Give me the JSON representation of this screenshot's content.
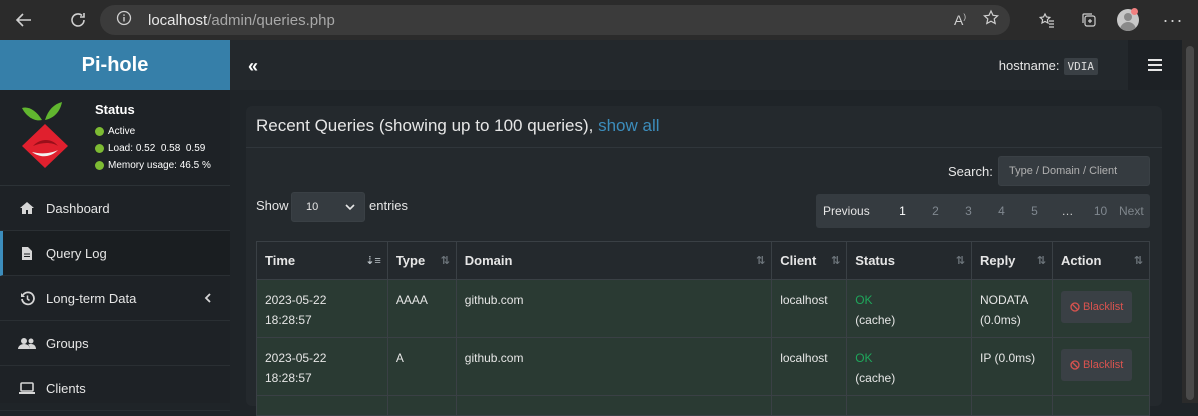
{
  "browser": {
    "url_host": "localhost",
    "url_path": "/admin/queries.php"
  },
  "sidebar": {
    "brand": "Pi-hole",
    "status": {
      "title": "Status",
      "active": "Active",
      "load_label": "Load:",
      "load_values": "0.52  0.58  0.59",
      "memory_label": "Memory usage:",
      "memory_value": "46.5 %"
    },
    "items": [
      {
        "label": "Dashboard",
        "icon": "home-icon"
      },
      {
        "label": "Query Log",
        "icon": "file-icon"
      },
      {
        "label": "Long-term Data",
        "icon": "history-icon"
      },
      {
        "label": "Groups",
        "icon": "users-icon"
      },
      {
        "label": "Clients",
        "icon": "laptop-icon"
      }
    ]
  },
  "header": {
    "toggle": "«",
    "hostname_label": "hostname:",
    "hostname_value": "VDIA"
  },
  "main": {
    "title": "Recent Queries (showing up to 100 queries), ",
    "show_all": "show all",
    "search_label": "Search:",
    "search_placeholder": "Type / Domain / Client",
    "show_label": "Show",
    "entries_value": "10",
    "entries_label": "entries",
    "pager": {
      "previous": "Previous",
      "pages": [
        "1",
        "2",
        "3",
        "4",
        "5",
        "…",
        "10"
      ],
      "next": "Next"
    },
    "columns": [
      "Time",
      "Type",
      "Domain",
      "Client",
      "Status",
      "Reply",
      "Action"
    ],
    "rows": [
      {
        "date": "2023-05-22",
        "time": "18:28:57",
        "type": "AAAA",
        "domain": "github.com",
        "client": "localhost",
        "status": "OK",
        "status_sub": "(cache)",
        "reply": "NODATA",
        "reply_sub": "(0.0ms)",
        "action": "Blacklist"
      },
      {
        "date": "2023-05-22",
        "time": "18:28:57",
        "type": "A",
        "domain": "github.com",
        "client": "localhost",
        "status": "OK",
        "status_sub": "(cache)",
        "reply": "IP (0.0ms)",
        "reply_sub": "",
        "action": "Blacklist"
      }
    ]
  },
  "colors": {
    "brand": "#367fa9",
    "link": "#3c8dbc",
    "ok": "#1fa65b",
    "blacklist": "#d9534f",
    "status_dot": "#7dbb33"
  }
}
